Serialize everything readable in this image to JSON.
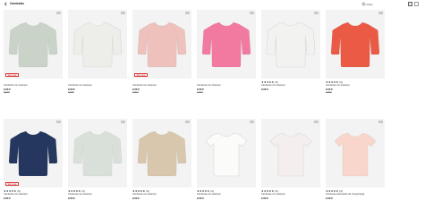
{
  "header": {
    "back_label": "Camisetas",
    "filter_label": "Filtra",
    "icons": {
      "back": "chevron-left-icon",
      "filter": "filter-sliders-icon",
      "grid_two": "grid-two-columns-icon",
      "grid_one": "grid-one-column-icon"
    }
  },
  "colors": {
    "tile_bg": "#f3f3f3",
    "badge_text": "#b21d1d",
    "price": "#111111",
    "old_price": "#777777"
  },
  "products": [
    {
      "color": "#c9d3c8",
      "badge": "Stop plus",
      "stars": "",
      "reviews": "",
      "name": "Camiseta con estampa",
      "price": "2,00 €",
      "old_price": "4,00 €"
    },
    {
      "color": "#ededea",
      "badge": "",
      "stars": "",
      "reviews": "",
      "name": "Camiseta con estampa",
      "price": "2,00 €",
      "old_price": "4,00 €"
    },
    {
      "color": "#eec1bd",
      "badge": "Stop plus",
      "stars": "",
      "reviews": "",
      "name": "Camiseta con estampa",
      "price": "2,00 €",
      "old_price": "4,00 €"
    },
    {
      "color": "#f27aa1",
      "badge": "",
      "stars": "",
      "reviews": "",
      "name": "Camiseta con estampa",
      "price": "2,00 €",
      "old_price": "4,00 €"
    },
    {
      "color": "#f2f2f0",
      "badge": "",
      "stars": "★★★★★",
      "reviews": "(9)",
      "name": "Camiseta con estampa",
      "price": "2,00 €",
      "old_price": ""
    },
    {
      "color": "#ea5a44",
      "badge": "",
      "stars": "★★★★★",
      "reviews": "(9)",
      "name": "Camiseta con estampa",
      "price": "2,00 €",
      "old_price": "4,00 €"
    },
    {
      "color": "#25375e",
      "badge": "Stop plus",
      "stars": "★★★★★",
      "reviews": "(9)",
      "name": "Camiseta con estampa",
      "price": "2,00 €",
      "old_price": ""
    },
    {
      "color": "#d9e0da",
      "badge": "",
      "stars": "★★★★★",
      "reviews": "(9)",
      "name": "Camiseta con estampa",
      "price": "2,00 €",
      "old_price": ""
    },
    {
      "color": "#d8c6ad",
      "badge": "",
      "stars": "★★★★★",
      "reviews": "(9)",
      "name": "Camiseta con estampa",
      "price": "2,00 €",
      "old_price": ""
    },
    {
      "color": "#fbfbfa",
      "badge": "",
      "stars": "★★★★★",
      "reviews": "(9)",
      "name": "Camiseta con estampa",
      "price": "2,00 €",
      "old_price": ""
    },
    {
      "color": "#f4efee",
      "badge": "",
      "stars": "★★★★★",
      "reviews": "(9)",
      "name": "Camiseta con estampa",
      "price": "2,00 €",
      "old_price": ""
    },
    {
      "color": "#f8d6cc",
      "badge": "",
      "stars": "★★★★★",
      "reviews": "(9)",
      "name": "Camiseta estampado de manga larga",
      "price": "2,00 €",
      "old_price": ""
    }
  ]
}
